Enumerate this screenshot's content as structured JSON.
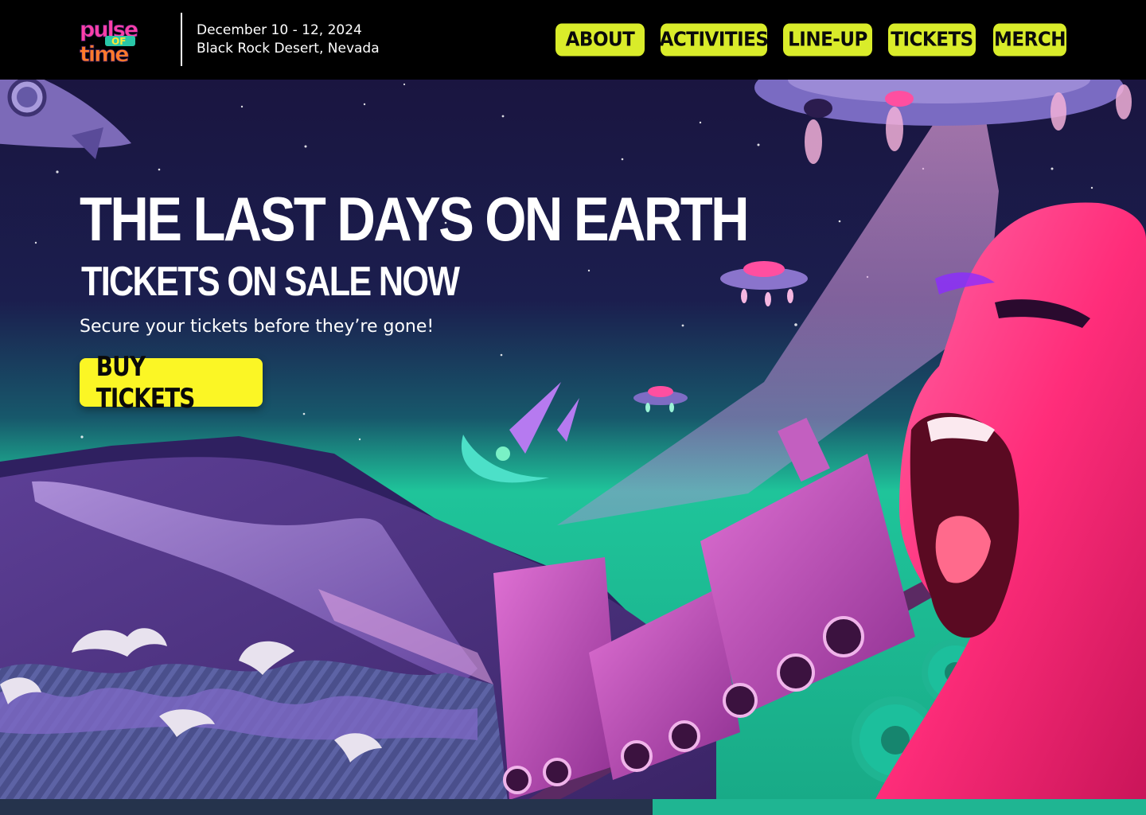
{
  "header": {
    "logo_text_top": "pulse",
    "logo_text_mid": "OF",
    "logo_text_bottom": "time",
    "event_dates": "December 10 - 12, 2024",
    "event_location": "Black Rock Desert, Nevada"
  },
  "nav": {
    "items": [
      {
        "label": "ABOUT"
      },
      {
        "label": "ACTIVITIES"
      },
      {
        "label": "LINE-UP"
      },
      {
        "label": "TICKETS"
      },
      {
        "label": "MERCH"
      }
    ]
  },
  "hero": {
    "title": "THE LAST DAYS ON EARTH",
    "subtitle": "TICKETS ON SALE NOW",
    "tagline": "Secure your tickets before they’re gone!",
    "cta_label": "BUY TICKETS"
  },
  "colors": {
    "nav_bg": "#d9ec2a",
    "cta_bg": "#fbf625",
    "header_bg": "#000000",
    "sky_top": "#1b1744",
    "sky_bottom": "#1fc49a",
    "accent_pink": "#ff2d7a",
    "accent_purple": "#6b4ba8"
  },
  "icons": {
    "logo": "pulse-of-time-logo"
  }
}
